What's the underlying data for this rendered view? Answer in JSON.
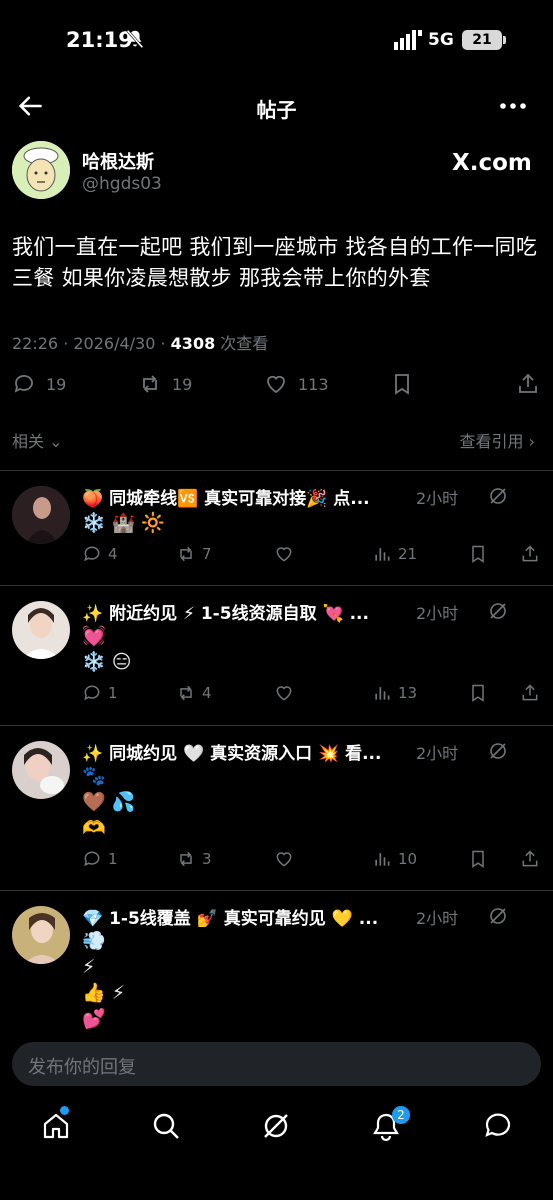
{
  "status_bar": {
    "time": "21:19",
    "network": "5G",
    "battery": "21"
  },
  "header": {
    "title": "帖子"
  },
  "post": {
    "author_name": "哈根达斯",
    "author_handle": "@hgds03",
    "source_label": "X.com",
    "text": "我们一直在一起吧 我们到一座城市 找各自的工作一同吃三餐 如果你凌晨想散步 那我会带上你的外套",
    "timestamp": "22:26 · 2026/4/30 · ",
    "views": "4308",
    "views_suffix": " 次查看",
    "replies": "19",
    "reposts": "19",
    "likes": "113"
  },
  "related": {
    "left_label": "相关",
    "right_label": "查看引用"
  },
  "feed": [
    {
      "title": "🍑 同城牵线🆚 真实可靠对接🎉 点...",
      "time": "2小时",
      "lines": [
        "❄️ 🏰 🔆"
      ],
      "replies": "4",
      "reposts": "7",
      "views": "21"
    },
    {
      "title": "✨ 附近约见 ⚡ 1-5线资源自取 💘 ...",
      "time": "2小时",
      "lines": [
        "💓",
        "❄️ 😑"
      ],
      "replies": "1",
      "reposts": "4",
      "views": "13"
    },
    {
      "title": "✨ 同城约见 🤍 真实资源入口 💥 看...",
      "time": "2小时",
      "lines": [
        "🐾",
        "🤎 💦",
        "🫶"
      ],
      "replies": "1",
      "reposts": "3",
      "views": "10"
    },
    {
      "title": "💎 1-5线覆盖 💅 真实可靠约见 💛 ...",
      "time": "2小时",
      "lines": [
        "💨",
        "⚡",
        "👍 ⚡",
        "💕"
      ]
    }
  ],
  "reply": {
    "placeholder": "发布你的回复"
  },
  "nav": {
    "notifications_badge": "2"
  },
  "colors": {
    "background": "#000000",
    "accent": "#1d9bf0",
    "muted": "#71767b",
    "divider": "#2f3336"
  }
}
